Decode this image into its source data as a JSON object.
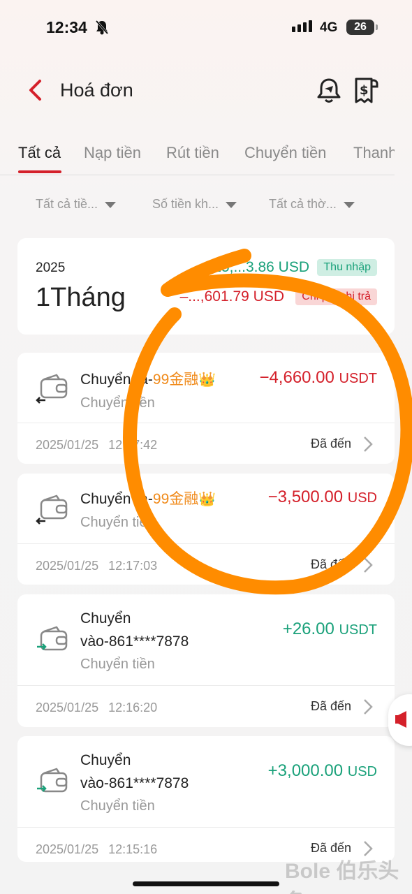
{
  "status_bar": {
    "time": "12:34",
    "network": "4G",
    "battery": "26"
  },
  "header": {
    "title": "Hoá đơn"
  },
  "tabs": [
    {
      "label": "Tất cả",
      "active": true
    },
    {
      "label": "Nạp tiền",
      "active": false
    },
    {
      "label": "Rút tiền",
      "active": false
    },
    {
      "label": "Chuyển tiền",
      "active": false
    },
    {
      "label": "Thanh",
      "active": false
    }
  ],
  "filters": [
    "Tất cả tiề...",
    "Số tiền kh...",
    "Tất cả thờ..."
  ],
  "summary": {
    "year": "2025",
    "period": "1Tháng",
    "income": "+15,...3.86 USD",
    "income_label": "Thu nhập",
    "expense": "–...,601.79 USD",
    "expense_label": "Chi phí chi trả"
  },
  "transactions": [
    {
      "title_prefix": "Chuyển ra-",
      "brand": "99金融",
      "crown": "👑",
      "subtitle": "Chuyển tiền",
      "amount": "−4,660.00",
      "unit": "USDT",
      "date": "2025/01/25",
      "time": "12:17:42",
      "status": "Đã đến"
    },
    {
      "title_prefix": "Chuyển ra-",
      "brand": "99金融",
      "crown": "👑",
      "subtitle": "Chuyển tiền",
      "amount": "−3,500.00",
      "unit": "USD",
      "date": "2025/01/25",
      "time": "12:17:03",
      "status": "Đã đến"
    },
    {
      "title_line1": "Chuyển",
      "title_line2": "vào-861****7878",
      "subtitle": "Chuyển tiền",
      "amount": "+26.00",
      "unit": "USDT",
      "date": "2025/01/25",
      "time": "12:16:20",
      "status": "Đã đến"
    },
    {
      "title_line1": "Chuyển",
      "title_line2": "vào-861****7878",
      "subtitle": "Chuyển tiền",
      "amount": "+3,000.00",
      "unit": "USD",
      "date": "2025/01/25",
      "time": "12:15:16",
      "status": "Đã đến"
    }
  ],
  "watermark": "Bole 伯乐头条",
  "colors": {
    "accent": "#d4202a",
    "positive": "#1aa17a",
    "brand": "#f08a1a",
    "annotation": "#ff8c00"
  }
}
